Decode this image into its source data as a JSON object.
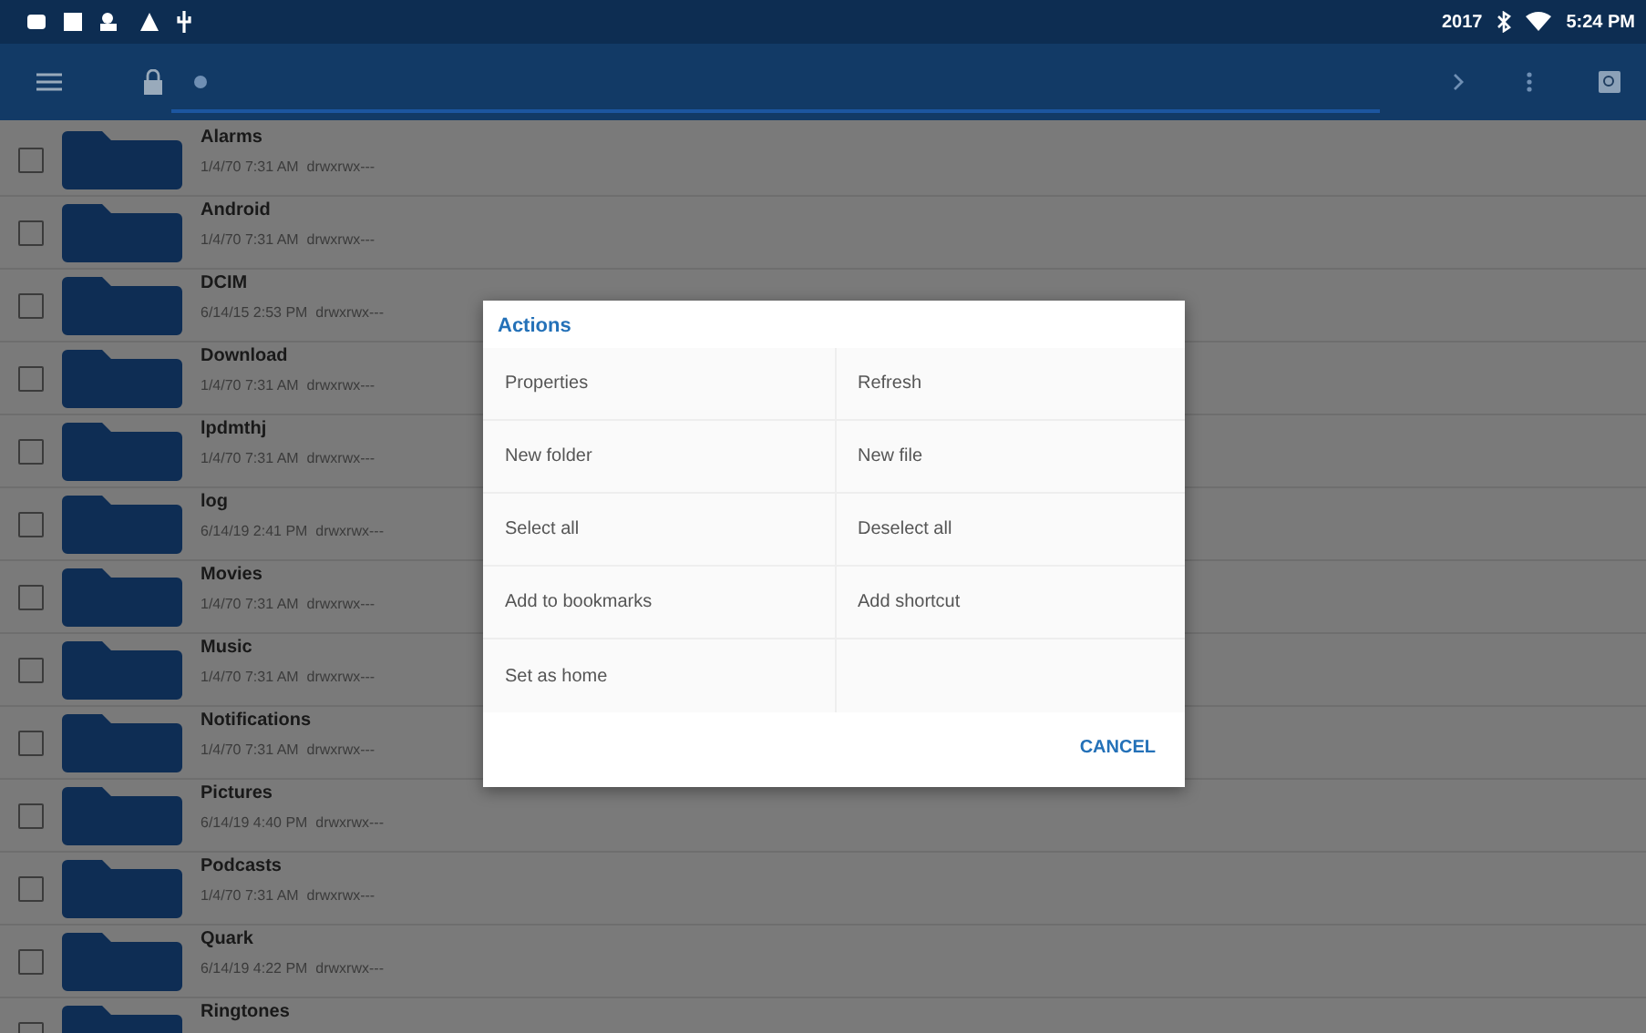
{
  "status_bar": {
    "year": "2017",
    "time": "5:24 PM"
  },
  "files": [
    {
      "name": "Alarms",
      "date": "1/4/70 7:31 AM",
      "perms": "drwxrwx---",
      "checked": false
    },
    {
      "name": "Android",
      "date": "1/4/70 7:31 AM",
      "perms": "drwxrwx---",
      "checked": false
    },
    {
      "name": "DCIM",
      "date": "6/14/15 2:53 PM",
      "perms": "drwxrwx---",
      "checked": false
    },
    {
      "name": "Download",
      "date": "1/4/70 7:31 AM",
      "perms": "drwxrwx---",
      "checked": false
    },
    {
      "name": "lpdmthj",
      "date": "1/4/70 7:31 AM",
      "perms": "drwxrwx---",
      "checked": false
    },
    {
      "name": "log",
      "date": "6/14/19 2:41 PM",
      "perms": "drwxrwx---",
      "checked": false
    },
    {
      "name": "Movies",
      "date": "1/4/70 7:31 AM",
      "perms": "drwxrwx---",
      "checked": false
    },
    {
      "name": "Music",
      "date": "1/4/70 7:31 AM",
      "perms": "drwxrwx---",
      "checked": false
    },
    {
      "name": "Notifications",
      "date": "1/4/70 7:31 AM",
      "perms": "drwxrwx---",
      "checked": false
    },
    {
      "name": "Pictures",
      "date": "6/14/19 4:40 PM",
      "perms": "drwxrwx---",
      "checked": false
    },
    {
      "name": "Podcasts",
      "date": "1/4/70 7:31 AM",
      "perms": "drwxrwx---",
      "checked": false
    },
    {
      "name": "Quark",
      "date": "6/14/19 4:22 PM",
      "perms": "drwxrwx---",
      "checked": false
    },
    {
      "name": "Ringtones",
      "checked": false
    }
  ],
  "dialog": {
    "title": "Actions",
    "actions": [
      "Properties",
      "Refresh",
      "New folder",
      "New file",
      "Select all",
      "Deselect all",
      "Add to bookmarks",
      "Add shortcut",
      "Set as home"
    ],
    "cancel": "CANCEL"
  }
}
